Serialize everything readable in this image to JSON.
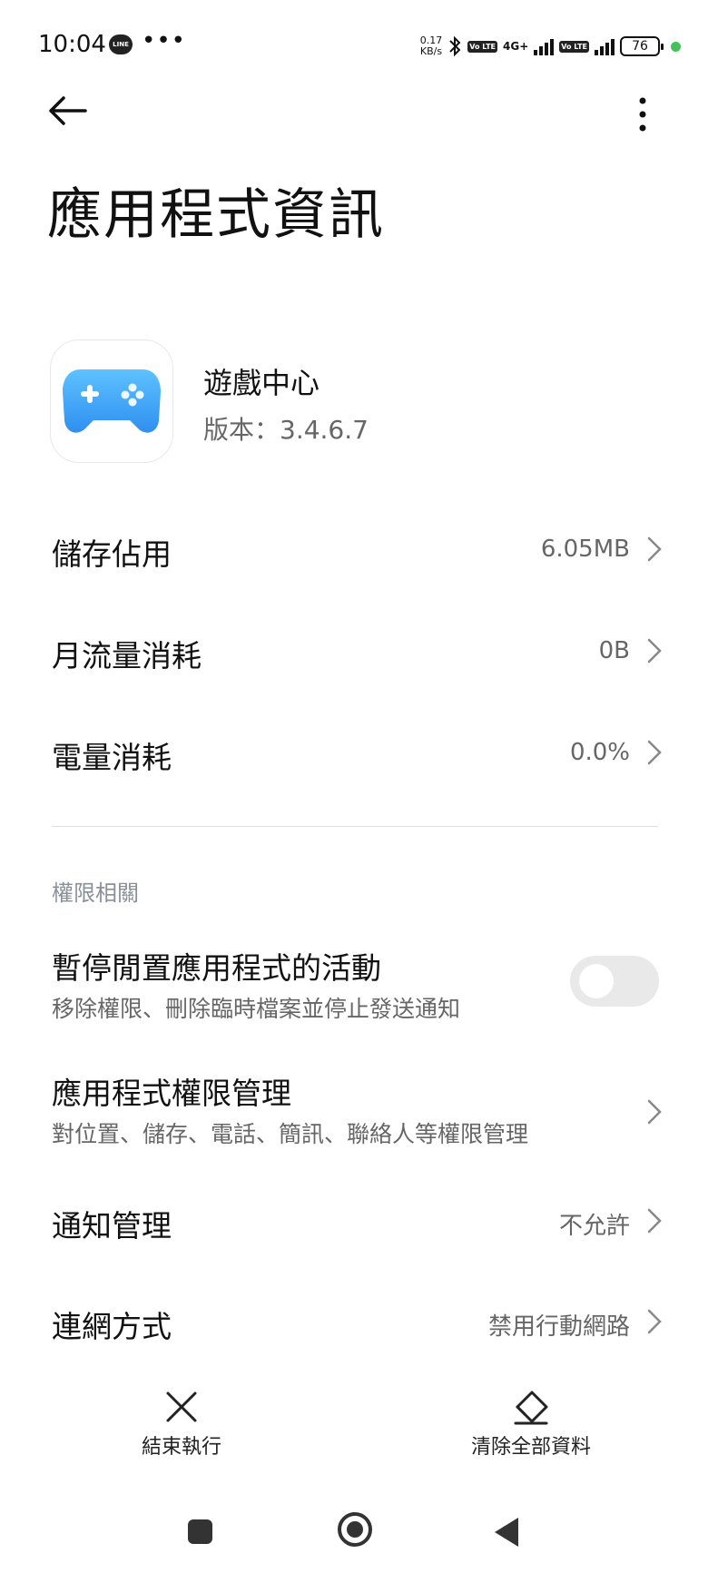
{
  "status_bar": {
    "time": "10:04",
    "line_badge": "LINE",
    "more_dots": "•••",
    "speed_value": "0.17",
    "speed_unit": "KB/s",
    "volte1": "Vo LTE",
    "network": "4G+",
    "volte2": "Vo LTE",
    "battery": "76"
  },
  "header": {
    "title": "應用程式資訊"
  },
  "app": {
    "name": "遊戲中心",
    "version": "版本：3.4.6.7",
    "icon_color": "#3aa0ee"
  },
  "usage_rows": [
    {
      "label": "儲存佔用",
      "value": "6.05MB"
    },
    {
      "label": "月流量消耗",
      "value": "0B"
    },
    {
      "label": "電量消耗",
      "value": "0.0%"
    }
  ],
  "permissions": {
    "section_title": "權限相關",
    "pause_activity": {
      "label": "暫停閒置應用程式的活動",
      "sub": "移除權限、刪除臨時檔案並停止發送通知",
      "enabled": false
    },
    "permission_manage": {
      "label": "應用程式權限管理",
      "sub": "對位置、儲存、電話、簡訊、聯絡人等權限管理"
    },
    "notifications": {
      "label": "通知管理",
      "value": "不允許"
    },
    "network_mode": {
      "label": "連網方式",
      "value": "禁用行動網路"
    }
  },
  "bottom_actions": {
    "force_stop": "結束執行",
    "clear_data": "清除全部資料"
  }
}
